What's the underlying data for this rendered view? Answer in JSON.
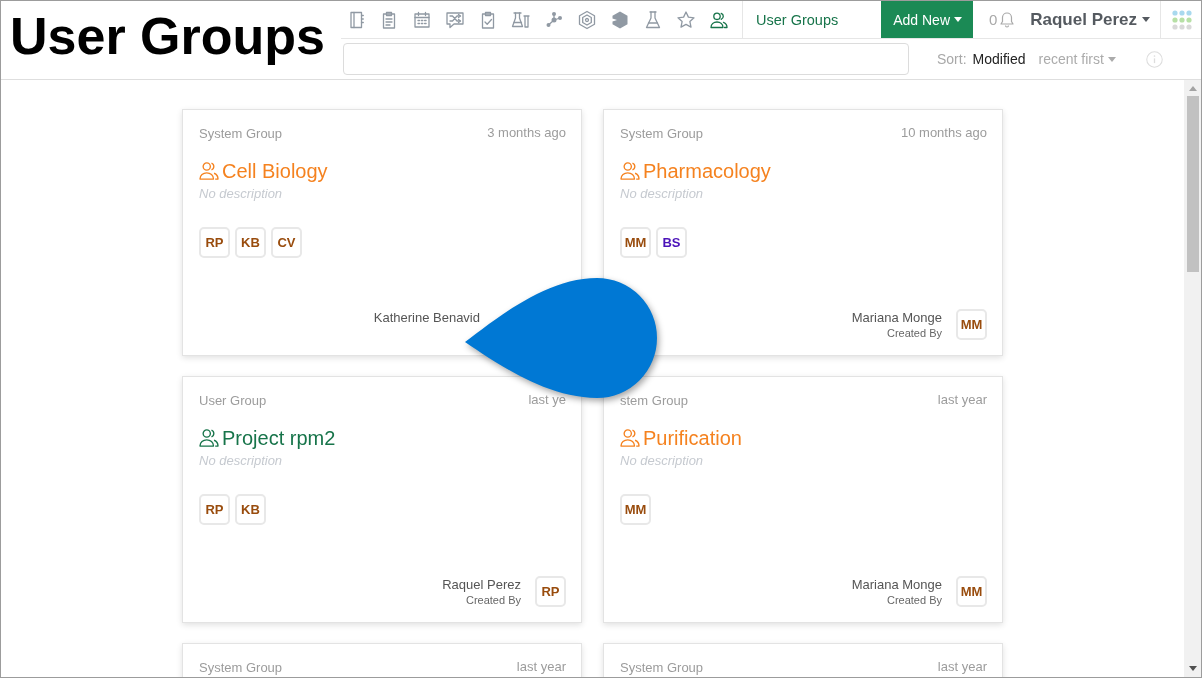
{
  "title_caption": "User Groups",
  "nav": {
    "tools": [
      {
        "selected": false
      },
      {
        "selected": false
      },
      {
        "selected": false
      },
      {
        "selected": false
      },
      {
        "selected": false
      },
      {
        "selected": false
      },
      {
        "selected": false
      },
      {
        "selected": false
      },
      {
        "selected": false
      },
      {
        "selected": false
      },
      {
        "selected": false
      },
      {
        "selected": true
      }
    ],
    "page_label": "User Groups",
    "add_new": "Add New",
    "notification_count": "0",
    "user_name": "Raquel Perez"
  },
  "sort_bar": {
    "sort_label": "Sort:",
    "sort_field": "Modified",
    "sort_order": "recent first"
  },
  "groups": [
    {
      "kind": "system",
      "type": "System Group",
      "time": "3 months ago",
      "name": "Cell Biology",
      "description": "No description",
      "members": [
        {
          "initials": "RP",
          "color": "#994c0d"
        },
        {
          "initials": "KB",
          "color": "#994c0d"
        },
        {
          "initials": "CV",
          "color": "#994c0d"
        }
      ],
      "creator": {
        "name": "Katherine Benavid"
      }
    },
    {
      "kind": "system",
      "type": "System Group",
      "time": "10 months ago",
      "name": "Pharmacology",
      "description": "No description",
      "members": [
        {
          "initials": "MM",
          "color": "#994c0d"
        },
        {
          "initials": "BS",
          "color": "#4b12b9"
        }
      ],
      "creator": {
        "name": "Mariana Monge",
        "label": "Created By",
        "initials": "MM",
        "color": "#994c0d"
      }
    },
    {
      "kind": "user",
      "type": "User Group",
      "time": "last ye",
      "name": "Project rpm2",
      "description": "No description",
      "members": [
        {
          "initials": "RP",
          "color": "#994c0d"
        },
        {
          "initials": "KB",
          "color": "#994c0d"
        }
      ],
      "creator": {
        "name": "Raquel Perez",
        "label": "Created By",
        "initials": "RP",
        "color": "#994c0d"
      }
    },
    {
      "kind": "system",
      "type": "stem Group",
      "time": "last year",
      "name": "Purification",
      "description": "No description",
      "members": [
        {
          "initials": "MM",
          "color": "#994c0d"
        }
      ],
      "creator": {
        "name": "Mariana Monge",
        "label": "Created By",
        "initials": "MM",
        "color": "#994c0d"
      }
    },
    {
      "type": "System Group",
      "time": "last year"
    },
    {
      "type": "System Group",
      "time": "last year"
    }
  ]
}
